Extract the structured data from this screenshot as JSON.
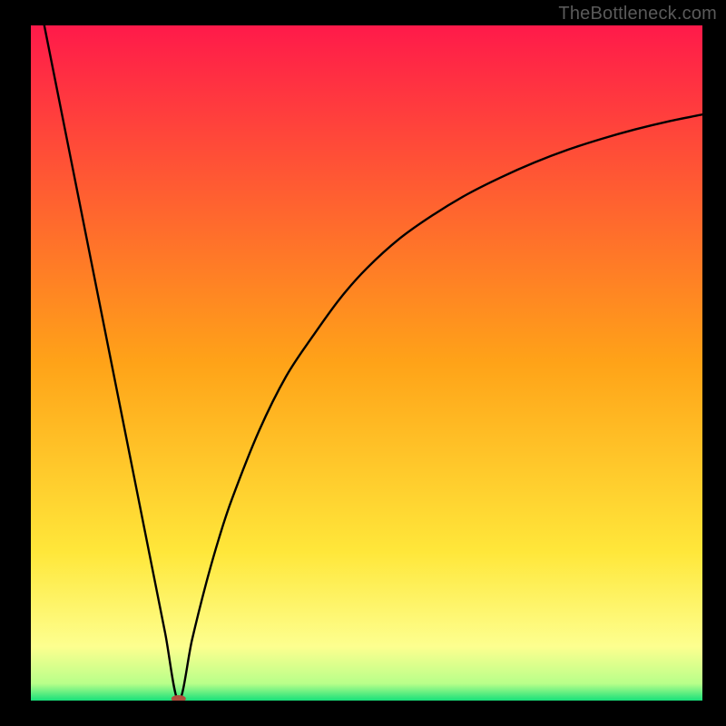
{
  "watermark": "TheBottleneck.com",
  "chart_data": {
    "type": "line",
    "title": "",
    "xlabel": "",
    "ylabel": "",
    "xlim": [
      0,
      100
    ],
    "ylim": [
      0,
      100
    ],
    "background_gradient": {
      "stops": [
        {
          "offset": 0.0,
          "color": "#ff1a4a"
        },
        {
          "offset": 0.5,
          "color": "#ffa318"
        },
        {
          "offset": 0.78,
          "color": "#ffe73a"
        },
        {
          "offset": 0.92,
          "color": "#fdff8f"
        },
        {
          "offset": 0.975,
          "color": "#b8ff8a"
        },
        {
          "offset": 1.0,
          "color": "#18e07a"
        }
      ]
    },
    "minimum_marker": {
      "x": 22,
      "y": 0,
      "color": "#b1503e",
      "rx": 8,
      "ry": 4
    },
    "series": [
      {
        "name": "curve",
        "color": "#000000",
        "x": [
          2,
          4,
          6,
          8,
          10,
          12,
          14,
          16,
          18,
          20,
          22,
          24,
          26,
          28,
          30,
          34,
          38,
          42,
          46,
          50,
          55,
          60,
          65,
          70,
          75,
          80,
          85,
          90,
          95,
          100
        ],
        "values": [
          100,
          90,
          80,
          70,
          60,
          50,
          40,
          30,
          20,
          10,
          0,
          9,
          17,
          24,
          30,
          40,
          48,
          54,
          59.5,
          64,
          68.5,
          72,
          75,
          77.5,
          79.7,
          81.6,
          83.2,
          84.6,
          85.8,
          86.8
        ]
      }
    ]
  }
}
